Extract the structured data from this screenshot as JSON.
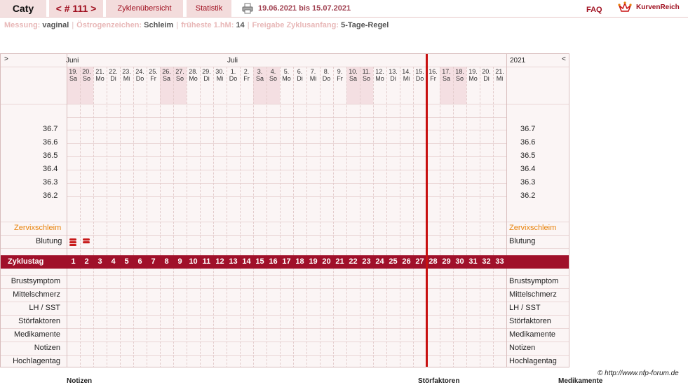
{
  "header": {
    "name": "Caty",
    "cycle": "< # 111 >",
    "overview": "Zyklenübersicht",
    "statistics": "Statistik",
    "period": "19.06.2021 bis 15.07.2021",
    "faq": "FAQ",
    "logo": "KurvenReich"
  },
  "subbar": {
    "measurement_label": "Messung:",
    "measurement_value": "vaginal",
    "estrogen_label": "Östrogenzeichen:",
    "estrogen_value": "Schleim",
    "earliest_label": "früheste 1.hM:",
    "earliest_value": "14",
    "release_label": "Freigabe Zyklusanfang:",
    "release_value": "5-Tage-Regel"
  },
  "chart": {
    "nav_left": ">",
    "nav_right": "<",
    "month1": "Juni",
    "month2": "Juli",
    "year": "2021",
    "days": [
      {
        "d": "19.",
        "w": "Sa",
        "we": true
      },
      {
        "d": "20.",
        "w": "So",
        "we": true
      },
      {
        "d": "21.",
        "w": "Mo",
        "we": false
      },
      {
        "d": "22.",
        "w": "Di",
        "we": false
      },
      {
        "d": "23.",
        "w": "Mi",
        "we": false
      },
      {
        "d": "24.",
        "w": "Do",
        "we": false
      },
      {
        "d": "25.",
        "w": "Fr",
        "we": false
      },
      {
        "d": "26.",
        "w": "Sa",
        "we": true
      },
      {
        "d": "27.",
        "w": "So",
        "we": true
      },
      {
        "d": "28.",
        "w": "Mo",
        "we": false
      },
      {
        "d": "29.",
        "w": "Di",
        "we": false
      },
      {
        "d": "30.",
        "w": "Mi",
        "we": false
      },
      {
        "d": "1.",
        "w": "Do",
        "we": false
      },
      {
        "d": "2.",
        "w": "Fr",
        "we": false
      },
      {
        "d": "3.",
        "w": "Sa",
        "we": true
      },
      {
        "d": "4.",
        "w": "So",
        "we": true
      },
      {
        "d": "5.",
        "w": "Mo",
        "we": false
      },
      {
        "d": "6.",
        "w": "Di",
        "we": false
      },
      {
        "d": "7.",
        "w": "Mi",
        "we": false
      },
      {
        "d": "8.",
        "w": "Do",
        "we": false
      },
      {
        "d": "9.",
        "w": "Fr",
        "we": false
      },
      {
        "d": "10.",
        "w": "Sa",
        "we": true
      },
      {
        "d": "11.",
        "w": "So",
        "we": true
      },
      {
        "d": "12.",
        "w": "Mo",
        "we": false
      },
      {
        "d": "13.",
        "w": "Di",
        "we": false
      },
      {
        "d": "14.",
        "w": "Mi",
        "we": false
      },
      {
        "d": "15.",
        "w": "Do",
        "we": false
      },
      {
        "d": "16.",
        "w": "Fr",
        "we": false
      },
      {
        "d": "17.",
        "w": "Sa",
        "we": true
      },
      {
        "d": "18.",
        "w": "So",
        "we": true
      },
      {
        "d": "19.",
        "w": "Mo",
        "we": false
      },
      {
        "d": "20.",
        "w": "Di",
        "we": false
      },
      {
        "d": "21.",
        "w": "Mi",
        "we": false
      }
    ],
    "temps": [
      "36.7",
      "36.6",
      "36.5",
      "36.4",
      "36.3",
      "36.2"
    ],
    "cervix_label": "Zervixschleim",
    "bleeding_label": "Blutung",
    "bleeding": [
      3,
      2
    ],
    "cycle_label": "Zyklustag",
    "cycle_days": [
      "1",
      "2",
      "3",
      "4",
      "5",
      "6",
      "7",
      "8",
      "9",
      "10",
      "11",
      "12",
      "13",
      "14",
      "15",
      "16",
      "17",
      "18",
      "19",
      "20",
      "21",
      "22",
      "23",
      "24",
      "25",
      "26",
      "27",
      "28",
      "29",
      "30",
      "31",
      "32",
      "33"
    ],
    "lower_rows": [
      "Brustsymptom",
      "Mittelschmerz",
      "LH / SST",
      "Störfaktoren",
      "Medikamente",
      "Notizen",
      "Hochlagentag"
    ],
    "today_index": 27
  },
  "footer": {
    "copyright": "© http://www.nfp-forum.de",
    "col1": "Notizen",
    "col2": "Störfaktoren",
    "col3": "Medikamente"
  },
  "colors": {
    "accent": "#a0102a",
    "today_line": "#c81010",
    "cervix": "#e8820a"
  }
}
